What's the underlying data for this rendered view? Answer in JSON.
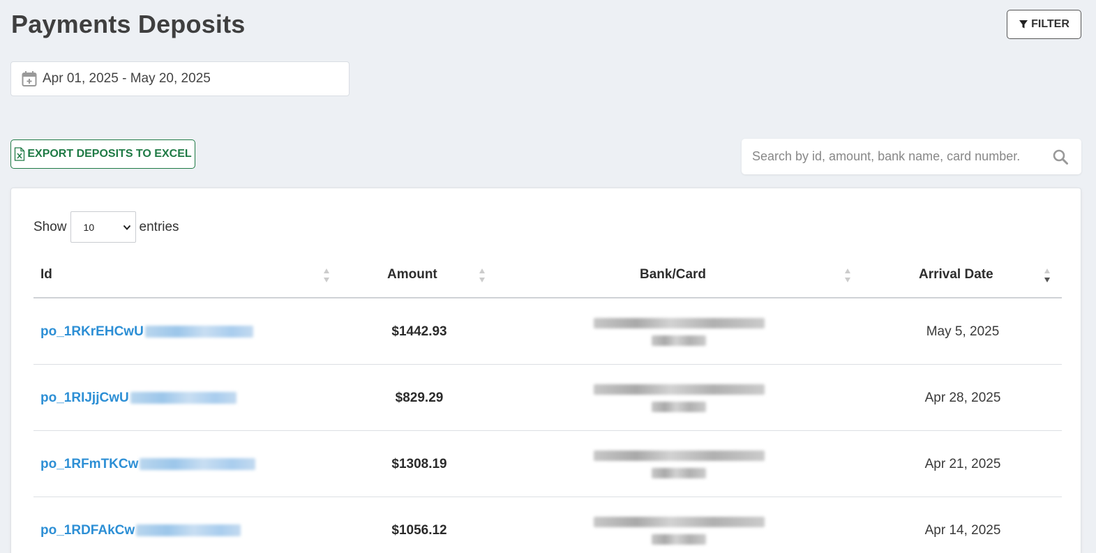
{
  "page": {
    "title": "Payments Deposits"
  },
  "toolbar": {
    "filter_label": "FILTER",
    "date_range": "Apr 01, 2025 - May 20, 2025",
    "export_label": "EXPORT DEPOSITS TO EXCEL",
    "search_placeholder": "Search by id, amount, bank name, card number."
  },
  "table": {
    "show_label": "Show",
    "entries_label": "entries",
    "page_size": "10",
    "columns": [
      "Id",
      "Amount",
      "Bank/Card",
      "Arrival Date"
    ],
    "rows": [
      {
        "id_prefix": "po_1RKrEHCwU",
        "amount": "$1442.93",
        "arrival_date": "May 5, 2025"
      },
      {
        "id_prefix": "po_1RIJjjCwU",
        "amount": "$829.29",
        "arrival_date": "Apr 28, 2025"
      },
      {
        "id_prefix": "po_1RFmTKCw",
        "amount": "$1308.19",
        "arrival_date": "Apr 21, 2025"
      },
      {
        "id_prefix": "po_1RDFAkCw",
        "amount": "$1056.12",
        "arrival_date": "Apr 14, 2025"
      }
    ]
  },
  "colors": {
    "background": "#edf0f4",
    "link": "#2d8fd5",
    "export_green": "#1f7a45"
  }
}
